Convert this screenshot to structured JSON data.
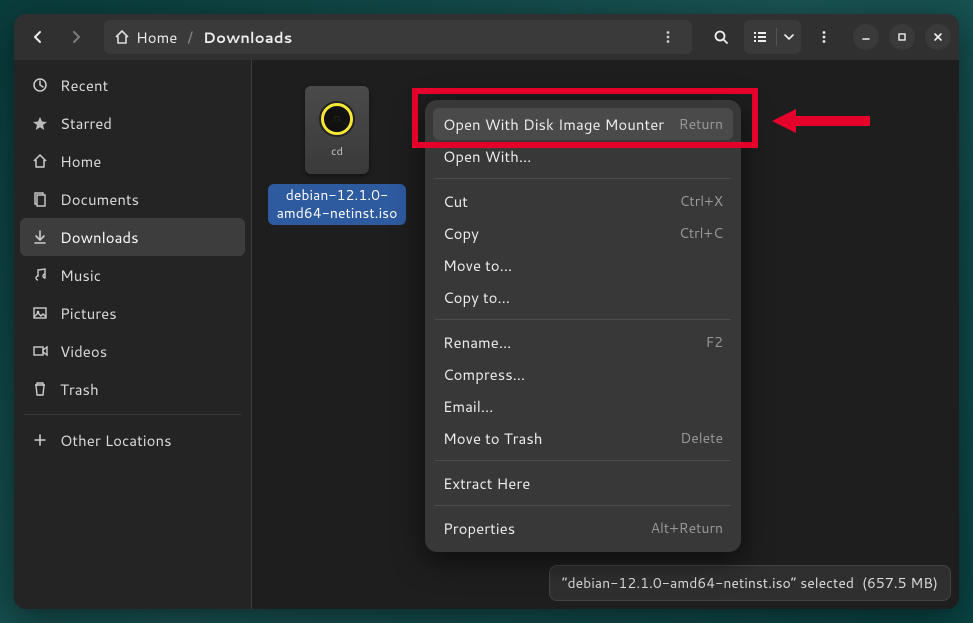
{
  "breadcrumb": {
    "home": "Home",
    "current": "Downloads"
  },
  "sidebar": {
    "items": [
      {
        "icon": "recent",
        "label": "Recent"
      },
      {
        "icon": "starred",
        "label": "Starred"
      },
      {
        "icon": "home",
        "label": "Home"
      },
      {
        "icon": "documents",
        "label": "Documents"
      },
      {
        "icon": "downloads",
        "label": "Downloads",
        "active": true
      },
      {
        "icon": "music",
        "label": "Music"
      },
      {
        "icon": "pictures",
        "label": "Pictures"
      },
      {
        "icon": "videos",
        "label": "Videos"
      },
      {
        "icon": "trash",
        "label": "Trash"
      }
    ],
    "other_locations": "Other Locations"
  },
  "file": {
    "type_label": "cd",
    "name": "debian-12.1.0-amd64-netinst.iso"
  },
  "context_menu": {
    "groups": [
      [
        {
          "label": "Open With Disk Image Mounter",
          "accel": "Return",
          "highlight": true
        },
        {
          "label": "Open With…",
          "accel": ""
        }
      ],
      [
        {
          "label": "Cut",
          "accel": "Ctrl+X"
        },
        {
          "label": "Copy",
          "accel": "Ctrl+C"
        },
        {
          "label": "Move to…",
          "accel": ""
        },
        {
          "label": "Copy to…",
          "accel": ""
        }
      ],
      [
        {
          "label": "Rename…",
          "accel": "F2"
        },
        {
          "label": "Compress…",
          "accel": ""
        },
        {
          "label": "Email…",
          "accel": ""
        },
        {
          "label": "Move to Trash",
          "accel": "Delete"
        }
      ],
      [
        {
          "label": "Extract Here",
          "accel": ""
        }
      ],
      [
        {
          "label": "Properties",
          "accel": "Alt+Return"
        }
      ]
    ]
  },
  "statusbar": {
    "text": "“debian-12.1.0-amd64-netinst.iso” selected",
    "size": "(657.5 MB)"
  }
}
